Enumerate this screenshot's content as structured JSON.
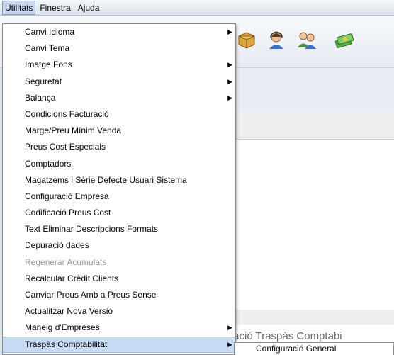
{
  "menubar": {
    "items": [
      {
        "label": "Utilitats",
        "active": true
      },
      {
        "label": "Finestra",
        "active": false
      },
      {
        "label": "Ajuda",
        "active": false
      }
    ]
  },
  "background": {
    "partial_title": "figuració Traspàs Comptabi"
  },
  "toolbar_icons": [
    "box-icon",
    "support-agent-icon",
    "users-icon",
    "money-icon"
  ],
  "dropdown": {
    "items": [
      {
        "label": "Canvi Idioma",
        "submenu": true,
        "disabled": false
      },
      {
        "label": "Canvi Tema",
        "submenu": false,
        "disabled": false
      },
      {
        "label": "Imatge Fons",
        "submenu": true,
        "disabled": false
      },
      {
        "label": "Seguretat",
        "submenu": true,
        "disabled": false
      },
      {
        "label": "Balança",
        "submenu": true,
        "disabled": false
      },
      {
        "label": "Condicions Facturació",
        "submenu": false,
        "disabled": false
      },
      {
        "label": "Marge/Preu Mínim Venda",
        "submenu": false,
        "disabled": false
      },
      {
        "label": "Preus Cost Especials",
        "submenu": false,
        "disabled": false
      },
      {
        "label": "Comptadors",
        "submenu": false,
        "disabled": false
      },
      {
        "label": "Magatzems i Sèrie Defecte Usuari Sistema",
        "submenu": false,
        "disabled": false
      },
      {
        "label": "Configuració Empresa",
        "submenu": false,
        "disabled": false
      },
      {
        "label": "Codificació Preus Cost",
        "submenu": false,
        "disabled": false
      },
      {
        "label": "Text Eliminar Descripcions Formats",
        "submenu": false,
        "disabled": false
      },
      {
        "label": "Depuració dades",
        "submenu": false,
        "disabled": false
      },
      {
        "label": "Regenerar Acumulats",
        "submenu": false,
        "disabled": true
      },
      {
        "label": "Recalcular Crèdit Clients",
        "submenu": false,
        "disabled": false
      },
      {
        "label": "Canviar Preus Amb a Preus Sense",
        "submenu": false,
        "disabled": false
      },
      {
        "label": "Actualitzar Nova Versió",
        "submenu": false,
        "disabled": false
      },
      {
        "label": "Maneig d'Empreses",
        "submenu": true,
        "disabled": false
      },
      {
        "label": "Traspàs Comptabilitat",
        "submenu": true,
        "disabled": false,
        "highlighted": true
      }
    ]
  },
  "submenu": {
    "items": [
      {
        "label": "Configuració General"
      }
    ]
  },
  "colors": {
    "highlight": "#c7daf3",
    "disabled_text": "#9a9a9a"
  }
}
